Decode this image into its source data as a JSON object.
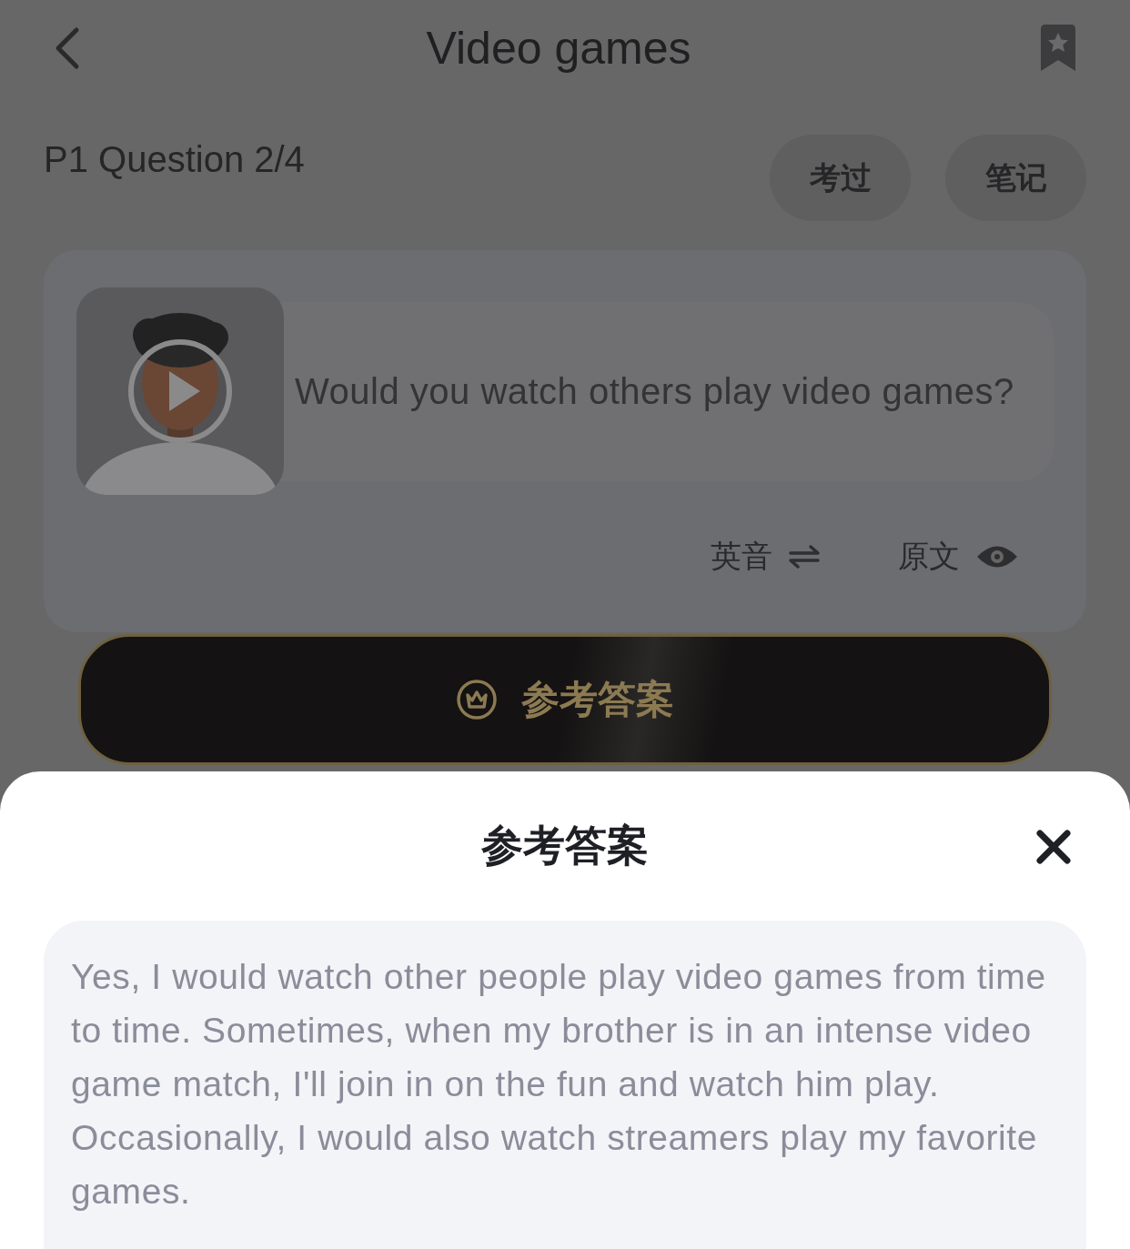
{
  "header": {
    "title": "Video games"
  },
  "question_bar": {
    "label": "P1 Question 2/4",
    "buttons": [
      {
        "label": "考过"
      },
      {
        "label": "笔记"
      }
    ]
  },
  "question_card": {
    "question": "Would you watch others play video games?",
    "accent_toggle": {
      "label": "英音"
    },
    "transcript_toggle": {
      "label": "原文"
    }
  },
  "answer_button": {
    "label": "参考答案"
  },
  "sheet": {
    "title": "参考答案",
    "answer": "Yes, I would watch other people play video games from time to time. Sometimes, when my brother is in an intense video game match, I'll join in on the fun and watch him play. Occasionally, I would also watch streamers play my favorite games."
  }
}
